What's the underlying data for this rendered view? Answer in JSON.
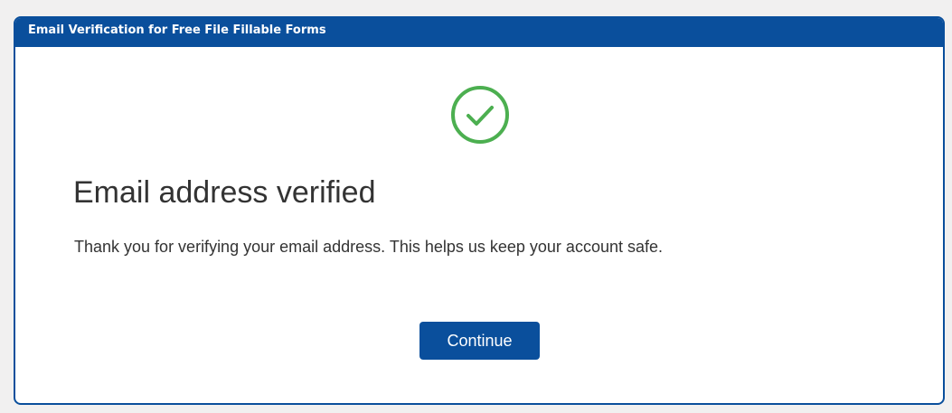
{
  "dialog": {
    "title": "Email Verification for Free File Fillable Forms",
    "icon": "check-circle-icon",
    "heading": "Email address verified",
    "message": "Thank you for verifying your email address. This helps us keep your account safe.",
    "continue_label": "Continue"
  },
  "colors": {
    "brand": "#0a4f9c",
    "success": "#4caf50",
    "text": "#333333",
    "background": "#f1f0f0"
  }
}
